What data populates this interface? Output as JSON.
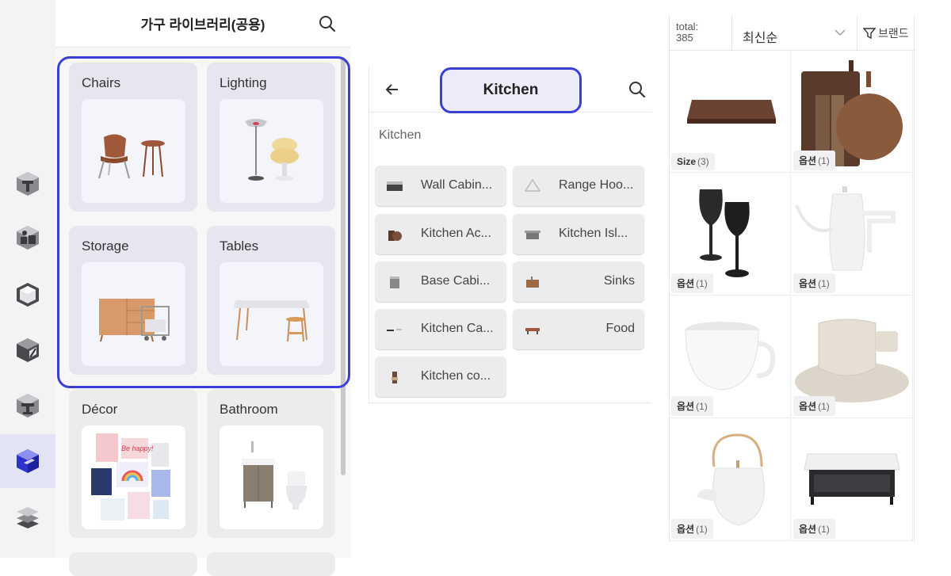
{
  "library": {
    "title": "가구 라이브러리(공용)",
    "categories": [
      {
        "label": "Chairs"
      },
      {
        "label": "Lighting"
      },
      {
        "label": "Storage"
      },
      {
        "label": "Tables"
      },
      {
        "label": "Décor"
      },
      {
        "label": "Bathroom"
      }
    ],
    "decor_text": "Be happy!"
  },
  "rail": {
    "items": [
      {
        "icon": "wall-cube-icon"
      },
      {
        "icon": "furniture-cube-icon"
      },
      {
        "icon": "room-cube-icon"
      },
      {
        "icon": "edit-cube-icon"
      },
      {
        "icon": "structure-cube-icon"
      },
      {
        "icon": "library-cube-icon",
        "active": true
      },
      {
        "icon": "layers-icon"
      }
    ],
    "active_color": "#3a3fd6"
  },
  "kitchen": {
    "title": "Kitchen",
    "subtitle": "Kitchen",
    "items": [
      {
        "label": "Wall Cabin..."
      },
      {
        "label": "Range Hoo..."
      },
      {
        "label": "Kitchen Ac..."
      },
      {
        "label": "Kitchen Isl..."
      },
      {
        "label": "Base Cabi..."
      },
      {
        "label": "Sinks"
      },
      {
        "label": "Kitchen Ca..."
      },
      {
        "label": "Food"
      },
      {
        "label": "Kitchen co..."
      }
    ]
  },
  "products": {
    "total_label": "total:",
    "total_count": "385",
    "sort_label": "최신순",
    "filter_label": "브랜드",
    "items": [
      {
        "badge_label": "Size",
        "badge_count": "(3)",
        "icon": "cutting-board-icon"
      },
      {
        "badge_label": "옵션",
        "badge_count": "(1)",
        "icon": "serving-boards-icon"
      },
      {
        "badge_label": "옵션",
        "badge_count": "(1)",
        "icon": "wine-glasses-icon"
      },
      {
        "badge_label": "옵션",
        "badge_count": "(1)",
        "icon": "kettle-icon"
      },
      {
        "badge_label": "옵션",
        "badge_count": "(1)",
        "icon": "mug-icon"
      },
      {
        "badge_label": "옵션",
        "badge_count": "(1)",
        "icon": "cup-saucer-icon"
      },
      {
        "badge_label": "옵션",
        "badge_count": "(1)",
        "icon": "teapot-icon"
      },
      {
        "badge_label": "옵션",
        "badge_count": "(1)",
        "icon": "kitchen-cart-icon"
      }
    ]
  },
  "colors": {
    "accent": "#3a3fd6",
    "highlight_fill": "#ebebfa"
  }
}
